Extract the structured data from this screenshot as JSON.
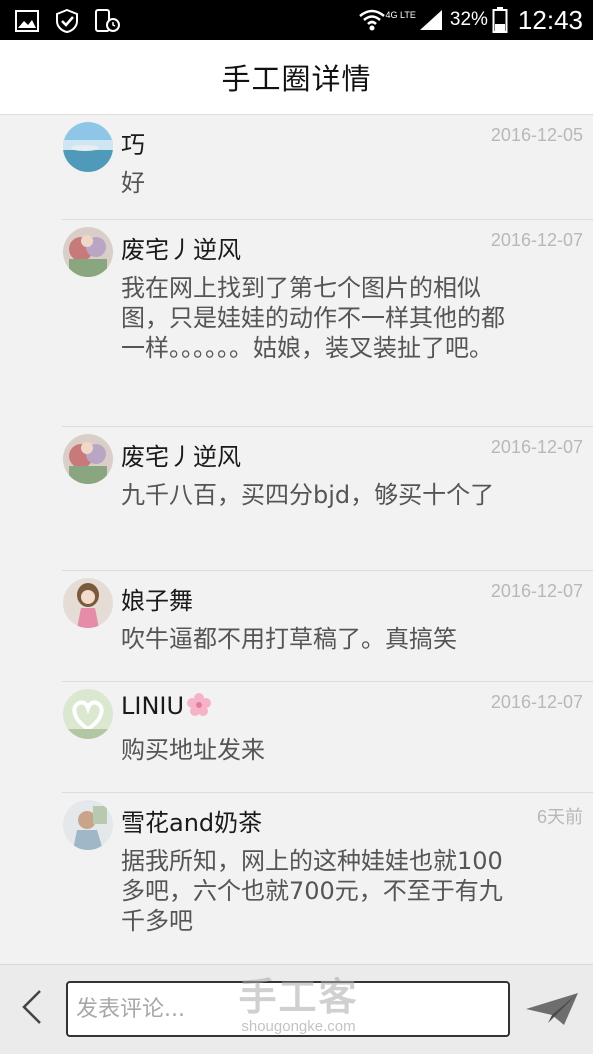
{
  "status_bar": {
    "left_icons": [
      "gallery-icon",
      "shield-check-icon",
      "phone-clock-icon"
    ],
    "network": "4G LTE",
    "battery_percent": "32%",
    "time": "12:43"
  },
  "header": {
    "title": "手工圈详情"
  },
  "comments": [
    {
      "name": "巧",
      "date": "2016-12-05",
      "text": "好"
    },
    {
      "name": "废宅丿逆风",
      "date": "2016-12-07",
      "text": "我在网上找到了第七个图片的相似图，只是娃娃的动作不一样其他的都一样。。。。。。姑娘，装叉装扯了吧。"
    },
    {
      "name": "废宅丿逆风",
      "date": "2016-12-07",
      "text": "九千八百，买四分bjd，够买十个了"
    },
    {
      "name": "娘子舞",
      "date": "2016-12-07",
      "text": "吹牛逼都不用打草稿了。真搞笑"
    },
    {
      "name": "LINIU",
      "date": "2016-12-07",
      "text": "购买地址发来"
    },
    {
      "name": "雪花and奶茶",
      "date": "6天前",
      "text": "据我所知，网上的这种娃娃也就100多吧，六个也就700元，不至于有九千多吧"
    }
  ],
  "input_bar": {
    "placeholder": "发表评论..."
  },
  "watermark": {
    "logo": "手工客",
    "url": "shougongke.com"
  },
  "colors": {
    "status_bar_bg": "#000000",
    "header_bg": "#ffffff",
    "list_bg": "#f2f2f2",
    "name_text": "#1a1a1a",
    "comment_text": "#555555",
    "date_text": "#b8b8b8"
  }
}
